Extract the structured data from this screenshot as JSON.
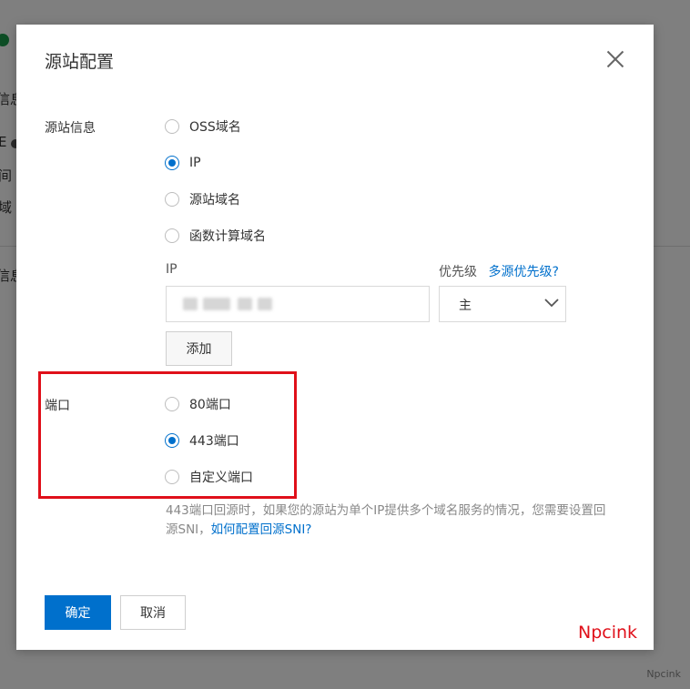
{
  "background": {
    "fragments": [
      "信息",
      "E",
      "间",
      "域",
      "信息"
    ]
  },
  "dialog": {
    "title": "源站配置",
    "origin_info": {
      "label": "源站信息",
      "options": [
        "OSS域名",
        "IP",
        "源站域名",
        "函数计算域名"
      ],
      "selected": "IP"
    },
    "ip": {
      "label": "IP",
      "value": ""
    },
    "priority": {
      "label": "优先级",
      "help_link": "多源优先级?",
      "selected": "主"
    },
    "add_button": "添加",
    "port": {
      "label": "端口",
      "options": [
        "80端口",
        "443端口",
        "自定义端口"
      ],
      "selected": "443端口"
    },
    "hint": {
      "text": "443端口回源时，如果您的源站为单个IP提供多个域名服务的情况，您需要设置回源SNI，",
      "link": "如何配置回源SNI?"
    },
    "ok_button": "确定",
    "cancel_button": "取消"
  },
  "watermark": "Npcink",
  "watermark_small": "Npcink",
  "colors": {
    "primary": "#0070cc",
    "annotation_red": "#e0101a"
  }
}
